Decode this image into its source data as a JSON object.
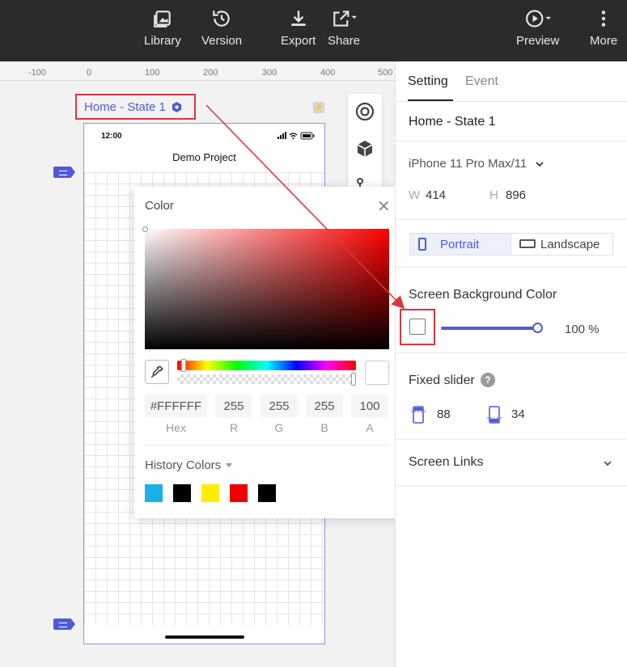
{
  "toolbar": {
    "library": "Library",
    "version": "Version",
    "export": "Export",
    "share": "Share",
    "preview": "Preview",
    "more": "More"
  },
  "ruler": {
    "ticks": [
      "-100",
      "0",
      "100",
      "200",
      "300",
      "400",
      "500"
    ]
  },
  "canvas": {
    "state_label": "Home - State 1",
    "phone": {
      "time": "12:00",
      "title": "Demo Project"
    }
  },
  "color_picker": {
    "title": "Color",
    "hex": "#FFFFFF",
    "r": "255",
    "g": "255",
    "b": "255",
    "a": "100",
    "labels": {
      "hex": "Hex",
      "r": "R",
      "g": "G",
      "b": "B",
      "a": "A"
    },
    "history_title": "History Colors",
    "history_colors": [
      "#1ab0e8",
      "#000000",
      "#ffee00",
      "#ee0000",
      "#000000"
    ]
  },
  "panel": {
    "tabs": {
      "setting": "Setting",
      "event": "Event"
    },
    "state_name": "Home - State 1",
    "device": "iPhone 11 Pro Max/11",
    "w_label": "W",
    "w_value": "414",
    "h_label": "H",
    "h_value": "896",
    "orientation": {
      "portrait": "Portrait",
      "landscape": "Landscape"
    },
    "bg_color_title": "Screen Background Color",
    "opacity": "100",
    "opacity_unit": "%",
    "fixed_slider_title": "Fixed slider",
    "fixed_top": "88",
    "fixed_bottom": "34",
    "screen_links": "Screen Links"
  },
  "colors": {
    "accent": "#4e5bd8",
    "highlight": "#d9363e",
    "toolbar_bg": "#2b2b2b"
  }
}
